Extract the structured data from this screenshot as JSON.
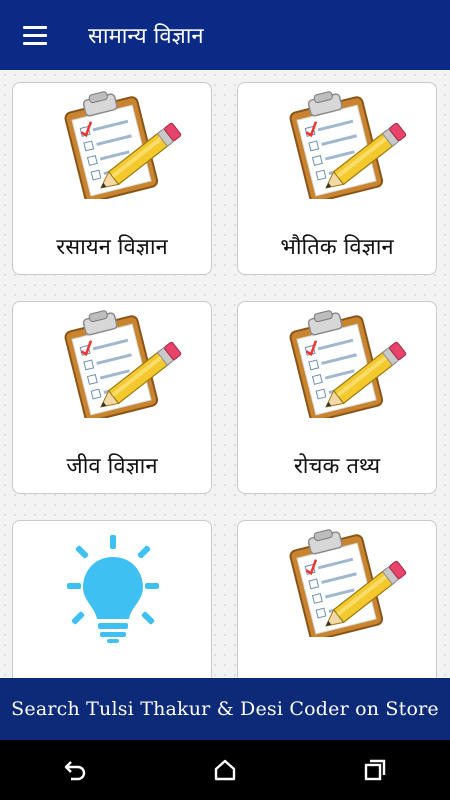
{
  "appbar": {
    "title": "सामान्य विज्ञान",
    "menu_icon": "hamburger-menu-icon"
  },
  "cards": [
    {
      "label": "रसायन विज्ञान",
      "icon": "clipboard-checklist-icon"
    },
    {
      "label": "भौतिक विज्ञान",
      "icon": "clipboard-checklist-icon"
    },
    {
      "label": "जीव विज्ञान",
      "icon": "clipboard-checklist-icon"
    },
    {
      "label": "रोचक तथ्य",
      "icon": "clipboard-checklist-icon"
    },
    {
      "label": "",
      "icon": "lightbulb-icon"
    },
    {
      "label": "",
      "icon": "clipboard-checklist-icon"
    }
  ],
  "banner": {
    "text": "Search Tulsi Thakur & Desi Coder on Store"
  },
  "navbar": {
    "icons": [
      "back-icon",
      "home-icon",
      "recents-icon"
    ]
  },
  "colors": {
    "appbar": "#0b2a86",
    "banner": "#0d2a78",
    "navbar": "#000000",
    "bulb": "#3ec1f2"
  }
}
